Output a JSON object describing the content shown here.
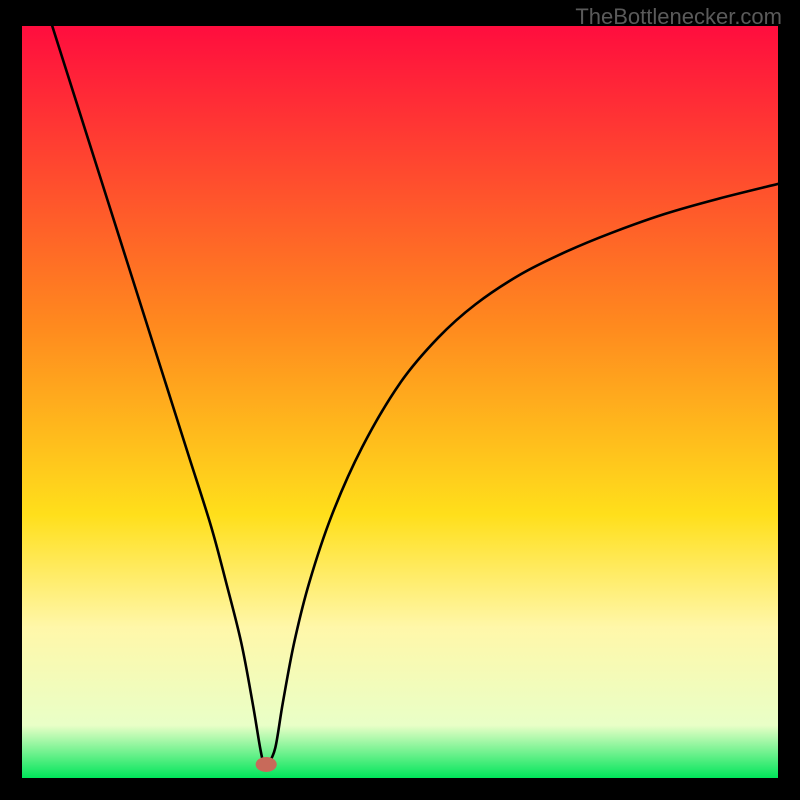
{
  "watermark": "TheBottlenecker.com",
  "chart_data": {
    "type": "line",
    "title": "",
    "xlabel": "",
    "ylabel": "",
    "xlim": [
      0,
      100
    ],
    "ylim": [
      0,
      100
    ],
    "grid": false,
    "legend": false,
    "background_gradient": {
      "stops": [
        {
          "offset": 0,
          "color": "#ff0d3e"
        },
        {
          "offset": 40,
          "color": "#ff8a1e"
        },
        {
          "offset": 65,
          "color": "#ffdf1b"
        },
        {
          "offset": 80,
          "color": "#fff7a9"
        },
        {
          "offset": 93,
          "color": "#e9ffc7"
        },
        {
          "offset": 100,
          "color": "#00e55a"
        }
      ]
    },
    "series": [
      {
        "name": "curve",
        "x": [
          4,
          7,
          10,
          13,
          16,
          19,
          22,
          25,
          27,
          29,
          30.5,
          31.5,
          32,
          32.5,
          33.5,
          34.5,
          36,
          38,
          41,
          45,
          50,
          55,
          60,
          66,
          72,
          78,
          85,
          92,
          100
        ],
        "y": [
          100,
          90.5,
          81,
          71.5,
          62,
          52.5,
          43,
          33.5,
          26,
          18,
          10,
          4,
          1.8,
          1.8,
          4,
          10,
          18,
          26,
          35,
          44,
          52.5,
          58.5,
          63,
          67,
          70,
          72.5,
          75,
          77,
          79
        ]
      }
    ],
    "marker": {
      "x": 32.3,
      "y": 1.8,
      "rx": 1.4,
      "ry": 1.0,
      "color": "#c86a5a"
    }
  }
}
